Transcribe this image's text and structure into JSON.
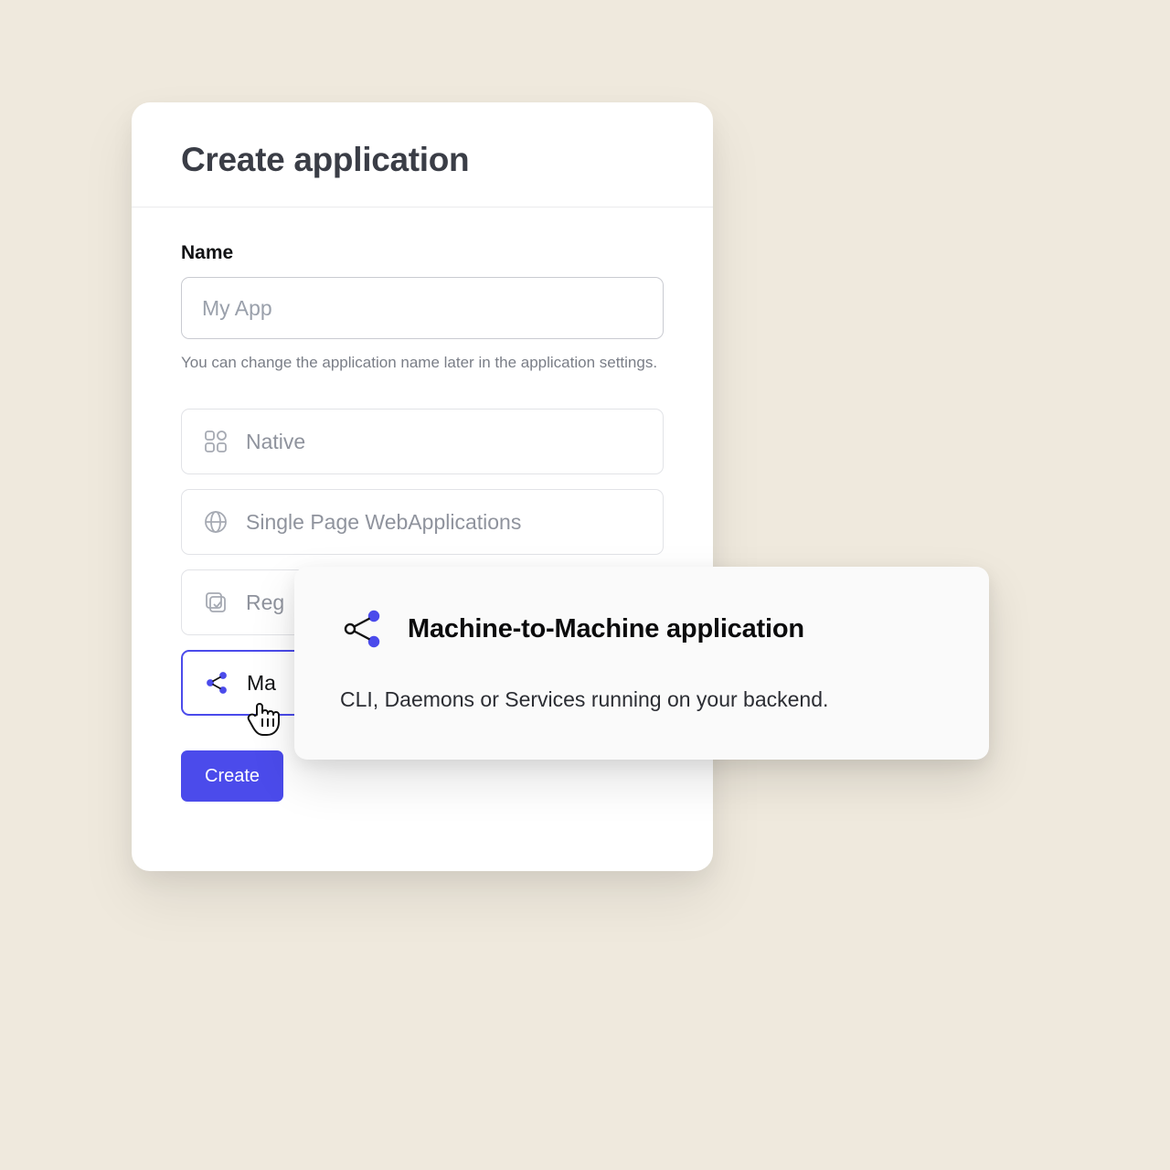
{
  "header": {
    "title": "Create application"
  },
  "form": {
    "name_label": "Name",
    "name_placeholder": "My App",
    "name_helper": "You can change the application name later in the application settings."
  },
  "options": [
    {
      "id": "native",
      "label": "Native",
      "icon": "apps"
    },
    {
      "id": "spa",
      "label": "Single Page WebApplications",
      "icon": "globe"
    },
    {
      "id": "regular",
      "label": "Reg",
      "icon": "stack"
    },
    {
      "id": "m2m",
      "label": "Ma",
      "icon": "share",
      "selected": true
    }
  ],
  "tooltip": {
    "title": "Machine-to-Machine application",
    "desc": "CLI, Daemons or Services running on your backend."
  },
  "buttons": {
    "create": "Create"
  }
}
